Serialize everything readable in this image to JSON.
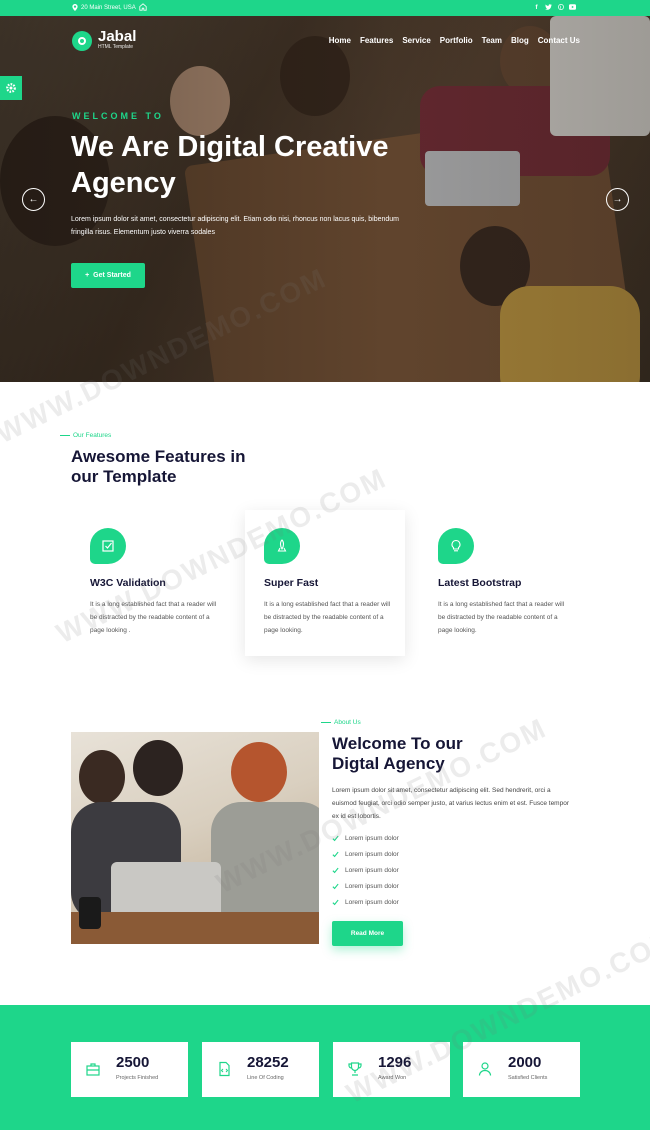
{
  "topbar": {
    "address": "20 Main Street, USA",
    "social_icons": [
      "facebook-icon",
      "twitter-icon",
      "pinterest-icon",
      "youtube-icon"
    ]
  },
  "brand": {
    "name": "Jabal",
    "tagline": "HTML Template"
  },
  "nav": {
    "items": [
      "Home",
      "Features",
      "Service",
      "Portfolio",
      "Team",
      "Blog",
      "Contact Us"
    ]
  },
  "hero": {
    "eyebrow": "WELCOME TO",
    "title": "We Are Digital Creative Agency",
    "text": "Lorem ipsum dolor sit amet, consectetur adipiscing elit. Etiam odio nisi, rhoncus non lacus quis, bibendum fringilla risus. Elementum justo viverra sodales",
    "cta": "Get Started",
    "prev_icon": "arrow-left-icon",
    "next_icon": "arrow-right-icon"
  },
  "features": {
    "label": "Our Features",
    "title_line1": "Awesome Features in",
    "title_line2": "our Template",
    "cards": [
      {
        "icon": "check-square-icon",
        "title": "W3C Validation",
        "text": "It is a long established fact that a reader will be distracted by the readable content of a page looking ."
      },
      {
        "icon": "rocket-icon",
        "title": "Super Fast",
        "text": "It is a long established fact that a reader will be distracted by the readable content of a page looking."
      },
      {
        "icon": "lightbulb-icon",
        "title": "Latest Bootstrap",
        "text": "It is a long established fact that a reader will be distracted by the readable content of a page looking."
      }
    ]
  },
  "about": {
    "label": "About Us",
    "title_line1": "Welcome To our",
    "title_line2": "Digtal Agency",
    "text": "Lorem ipsum dolor sit amet, consectetur adipiscing elit. Sed hendrerit, orci a euismod feugiat, orci odio semper justo, at varius lectus enim et est. Fusce tempor ex id est lobortis.",
    "list": [
      "Lorem ipsum dolor",
      "Lorem ipsum dolor",
      "Lorem ipsum dolor",
      "Lorem ipsum dolor",
      "Lorem ipsum dolor"
    ],
    "button": "Read More"
  },
  "stats": [
    {
      "icon": "briefcase-icon",
      "value": "2500",
      "label": "Projects Finished"
    },
    {
      "icon": "code-file-icon",
      "value": "28252",
      "label": "Line Of Coding"
    },
    {
      "icon": "trophy-icon",
      "value": "1296",
      "label": "Award Won"
    },
    {
      "icon": "user-icon",
      "value": "2000",
      "label": "Satisfied Clients"
    }
  ],
  "watermark": "WWW.DOWNDEMO.COM",
  "colors": {
    "accent": "#1ed68a",
    "heading": "#161636"
  }
}
